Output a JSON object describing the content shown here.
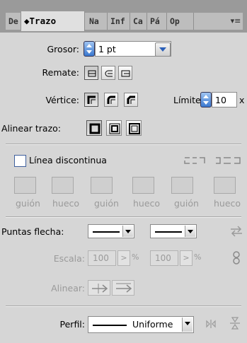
{
  "tabs": [
    {
      "label": "De"
    },
    {
      "label": "◆Trazo"
    },
    {
      "label": "Na"
    },
    {
      "label": "Inf"
    },
    {
      "label": "Ca"
    },
    {
      "label": "Pá"
    },
    {
      "label": "Op"
    }
  ],
  "stroke": {
    "weight_label": "Grosor:",
    "weight_value": "1 pt",
    "cap_label": "Remate:",
    "corner_label": "Vértice:",
    "limit_label": "Límite:",
    "limit_value": "10",
    "limit_unit": "x",
    "align_label": "Alinear trazo:"
  },
  "dashed": {
    "label": "Línea discontinua",
    "fields": [
      {
        "label": "guión"
      },
      {
        "label": "hueco"
      },
      {
        "label": "guión"
      },
      {
        "label": "hueco"
      },
      {
        "label": "guión"
      },
      {
        "label": "hueco"
      }
    ]
  },
  "arrowheads": {
    "label": "Puntas flecha:",
    "scale_label": "Escala:",
    "scale_start": "100",
    "scale_end": "100",
    "percent": "%",
    "align_label": "Alinear:"
  },
  "profile": {
    "label": "Perfil:",
    "value": "Uniforme"
  },
  "colors": {
    "panel_bg": "#d6d6d6",
    "accent": "#2a5fb8"
  }
}
